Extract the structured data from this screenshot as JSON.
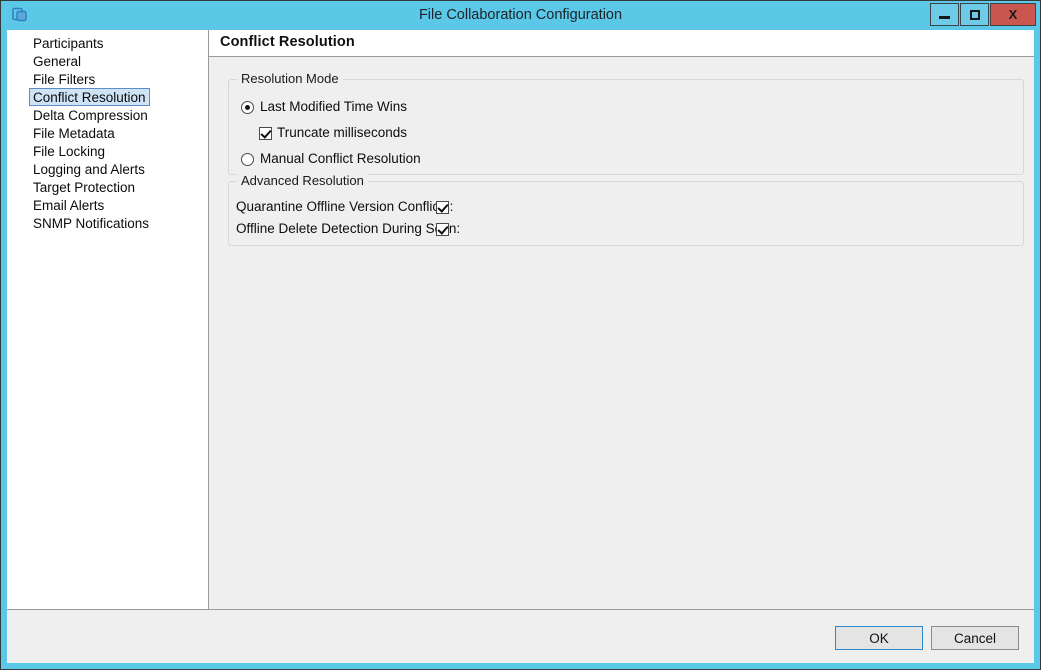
{
  "window": {
    "title": "File Collaboration Configuration",
    "icon": "file-collaboration-icon",
    "accent_color": "#5bc8e8",
    "close_color": "#c9564f",
    "controls": {
      "minimize_label": "Minimize",
      "maximize_label": "Maximize",
      "close_label": "X"
    }
  },
  "sidebar": {
    "selected": "Conflict Resolution",
    "items": [
      {
        "label": "Participants"
      },
      {
        "label": "General"
      },
      {
        "label": "File Filters"
      },
      {
        "label": "Conflict Resolution"
      },
      {
        "label": "Delta Compression"
      },
      {
        "label": "File Metadata"
      },
      {
        "label": "File Locking"
      },
      {
        "label": "Logging and Alerts"
      },
      {
        "label": "Target Protection"
      },
      {
        "label": "Email Alerts"
      },
      {
        "label": "SNMP Notifications"
      }
    ]
  },
  "content": {
    "header": "Conflict Resolution",
    "resolution_mode": {
      "legend": "Resolution Mode",
      "options": [
        {
          "label": "Last Modified Time Wins",
          "selected": true
        },
        {
          "label": "Manual Conflict Resolution",
          "selected": false
        }
      ],
      "sub_option": {
        "label": "Truncate milliseconds",
        "checked": true
      }
    },
    "advanced_resolution": {
      "legend": "Advanced Resolution",
      "rows": [
        {
          "label": "Quarantine Offline Version Conflicts:",
          "checked": true
        },
        {
          "label": "Offline Delete Detection During Scan:",
          "checked": true
        }
      ]
    }
  },
  "footer": {
    "ok_label": "OK",
    "cancel_label": "Cancel"
  }
}
